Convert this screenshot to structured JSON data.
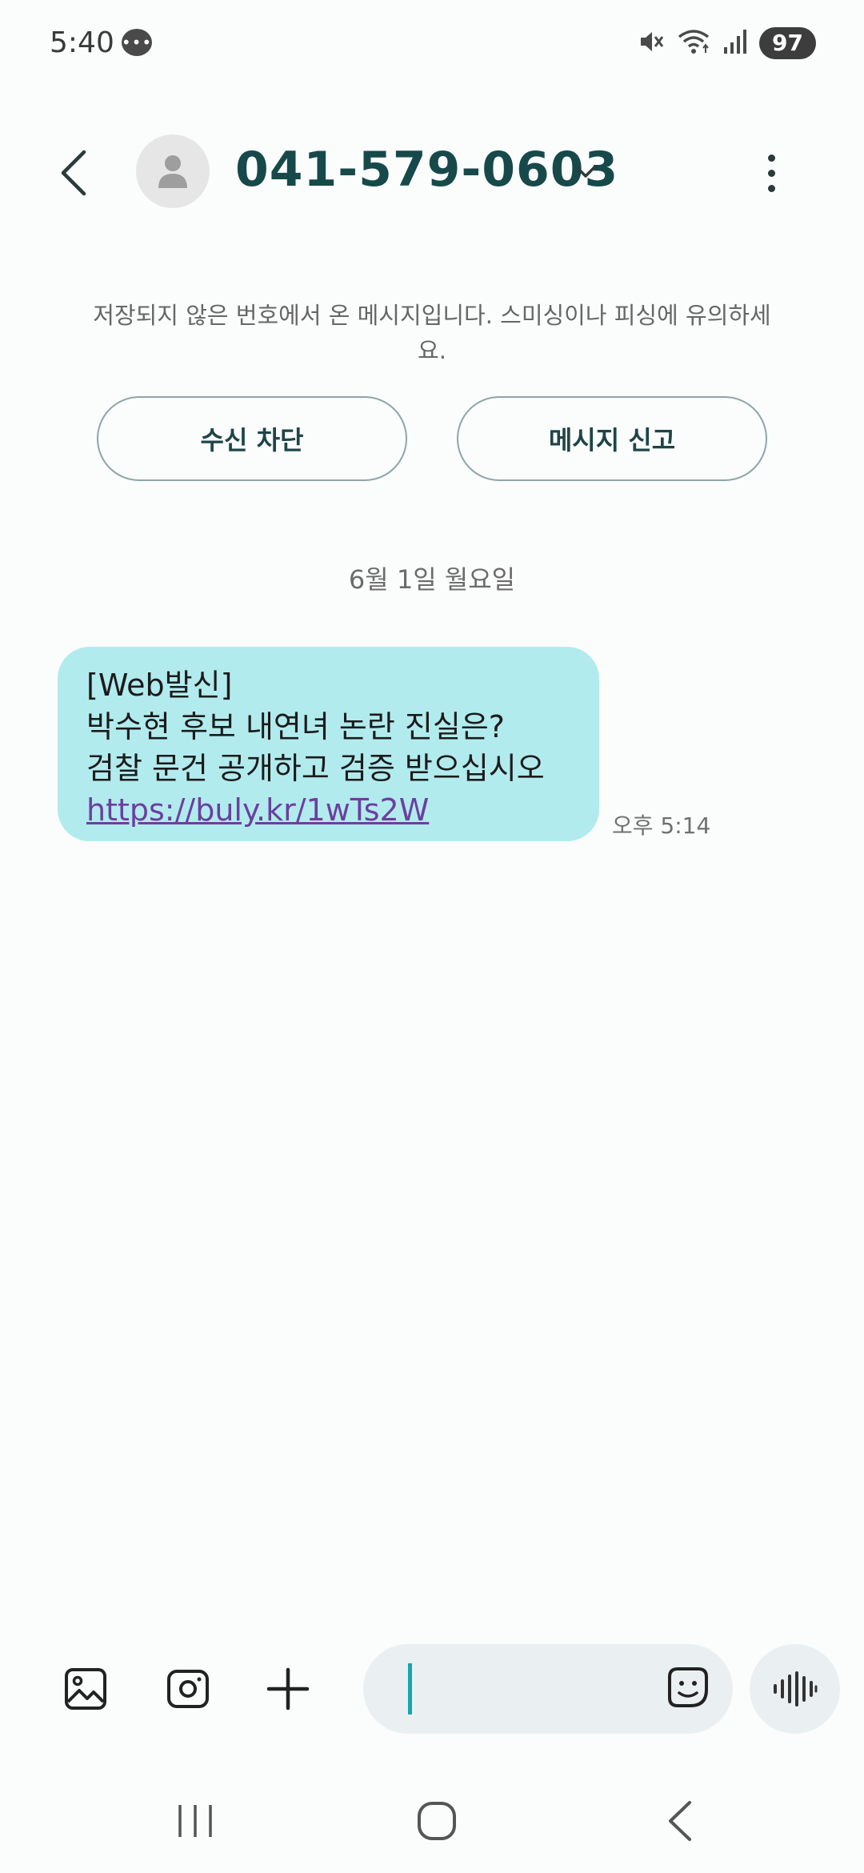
{
  "status_bar": {
    "time": "5:40",
    "battery": "97",
    "icons": [
      "chat-bubble-icon",
      "mute-icon",
      "wifi-icon",
      "signal-icon",
      "battery-icon"
    ]
  },
  "header": {
    "contact_number": "041-579-0603",
    "icons": [
      "back-icon",
      "avatar-person-icon",
      "chevron-down-icon",
      "more-vert-icon"
    ]
  },
  "warning": {
    "text": "저장되지 않은 번호에서 온 메시지입니다. 스미싱이나 피싱에 유의하세요.",
    "block_label": "수신 차단",
    "report_label": "메시지 신고"
  },
  "conversation": {
    "date_label": "6월 1일 월요일",
    "messages": [
      {
        "lines": [
          "[Web발신]",
          "박수현 후보 내연녀 논란 진실은?",
          "검찰 문건 공개하고 검증 받으십시오"
        ],
        "link": "https://buly.kr/1wTs2W",
        "time": "오후 5:14"
      }
    ]
  },
  "compose": {
    "input_value": "",
    "icons": [
      "gallery-icon",
      "camera-icon",
      "plus-icon",
      "emoji-icon",
      "voice-wave-icon"
    ]
  },
  "nav_bar": {
    "icons": [
      "recent-apps-icon",
      "home-icon",
      "back-nav-icon"
    ]
  },
  "colors": {
    "bubble": "#b2ebee",
    "contact_text": "#17494a",
    "link": "#6b3fa0",
    "cursor": "#19a6ad"
  }
}
